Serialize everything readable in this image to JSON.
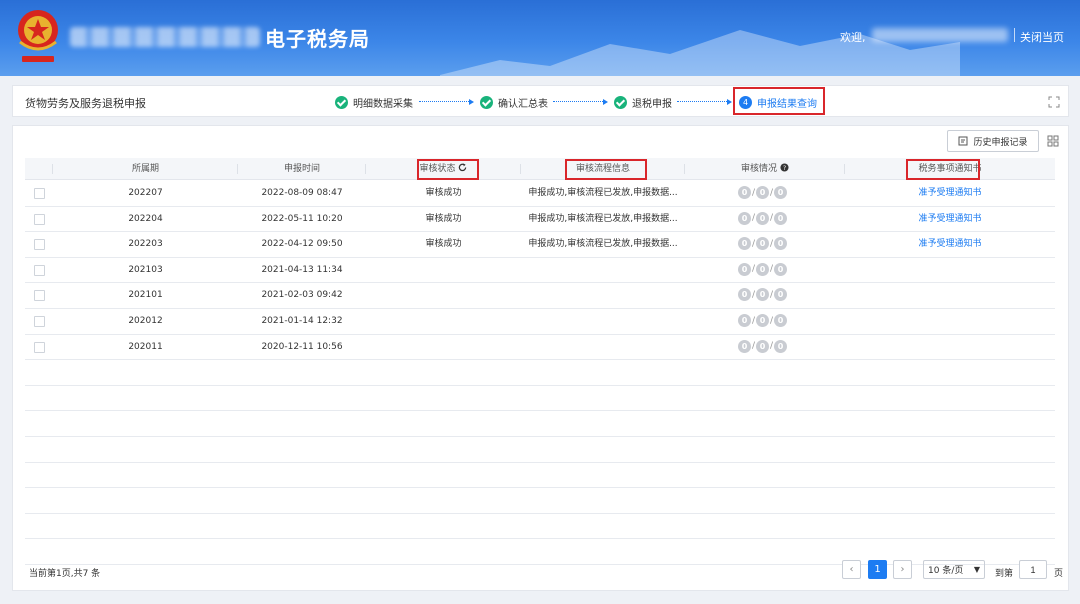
{
  "header": {
    "site_title": "电子税务局",
    "welcome": "欢迎,",
    "close_page": "关闭当页"
  },
  "stepbar": {
    "page_title": "货物劳务及服务退税申报",
    "steps": [
      {
        "label": "明细数据采集",
        "state": "done"
      },
      {
        "label": "确认汇总表",
        "state": "done"
      },
      {
        "label": "退税申报",
        "state": "done"
      },
      {
        "num": "4",
        "label": "申报结果查询",
        "state": "active"
      }
    ]
  },
  "toolbar": {
    "history_label": "历史申报记录"
  },
  "table": {
    "columns": [
      "所属期",
      "申报时间",
      "审核状态",
      "审核流程信息",
      "审核情况",
      "税务事项通知书"
    ],
    "rows": [
      {
        "period": "202207",
        "time": "2022-08-09 08:47",
        "status": "审核成功",
        "flow": "申报成功,审核流程已发放,申报数据...",
        "counts": [
          "0",
          "0",
          "0"
        ],
        "notice": "准予受理通知书"
      },
      {
        "period": "202204",
        "time": "2022-05-11 10:20",
        "status": "审核成功",
        "flow": "申报成功,审核流程已发放,申报数据...",
        "counts": [
          "0",
          "0",
          "0"
        ],
        "notice": "准予受理通知书"
      },
      {
        "period": "202203",
        "time": "2022-04-12 09:50",
        "status": "审核成功",
        "flow": "申报成功,审核流程已发放,申报数据...",
        "counts": [
          "0",
          "0",
          "0"
        ],
        "notice": "准予受理通知书"
      },
      {
        "period": "202103",
        "time": "2021-04-13 11:34",
        "status": "",
        "flow": "",
        "counts": [
          "0",
          "0",
          "0"
        ],
        "notice": ""
      },
      {
        "period": "202101",
        "time": "2021-02-03 09:42",
        "status": "",
        "flow": "",
        "counts": [
          "0",
          "0",
          "0"
        ],
        "notice": ""
      },
      {
        "period": "202012",
        "time": "2021-01-14 12:32",
        "status": "",
        "flow": "",
        "counts": [
          "0",
          "0",
          "0"
        ],
        "notice": ""
      },
      {
        "period": "202011",
        "time": "2020-12-11 10:56",
        "status": "",
        "flow": "",
        "counts": [
          "0",
          "0",
          "0"
        ],
        "notice": ""
      }
    ]
  },
  "pagination": {
    "info": "当前第1页,共7 条",
    "current_page": "1",
    "page_size": "10 条/页",
    "goto_label": "到第",
    "goto_value": "1",
    "page_suffix": "页"
  },
  "colors": {
    "accent": "#1d7cf2",
    "success": "#19b37b",
    "highlight": "#d9262b"
  }
}
